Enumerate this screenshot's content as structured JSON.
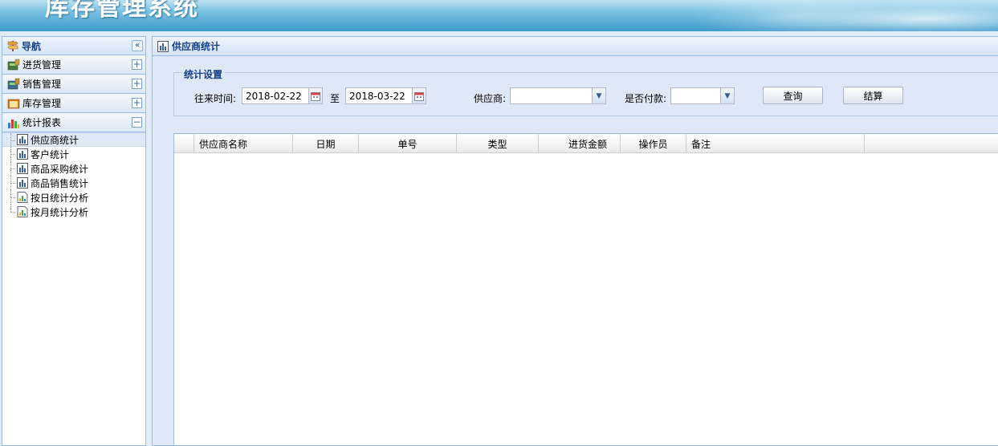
{
  "app": {
    "title": "库存管理系统"
  },
  "nav": {
    "title": "导航",
    "collapse_glyph": "«",
    "sections": [
      {
        "label": "进货管理",
        "toggle": "+"
      },
      {
        "label": "销售管理",
        "toggle": "+"
      },
      {
        "label": "库存管理",
        "toggle": "+"
      },
      {
        "label": "统计报表",
        "toggle": "−"
      }
    ],
    "tree": [
      {
        "label": "供应商统计"
      },
      {
        "label": "客户统计"
      },
      {
        "label": "商品采购统计"
      },
      {
        "label": "商品销售统计"
      },
      {
        "label": "按日统计分析"
      },
      {
        "label": "按月统计分析"
      }
    ]
  },
  "main": {
    "title": "供应商统计",
    "settings": {
      "legend": "统计设置",
      "time_label": "往来时间:",
      "start_date": "2018-02-22",
      "to_label": "至",
      "end_date": "2018-03-22",
      "supplier_label": "供应商:",
      "supplier_value": "",
      "paid_label": "是否付款:",
      "paid_value": "",
      "query_button": "查询",
      "settle_button": "结算"
    },
    "grid": {
      "columns": [
        "供应商名称",
        "日期",
        "单号",
        "类型",
        "进货金额",
        "操作员",
        "备注"
      ],
      "rows": []
    }
  }
}
